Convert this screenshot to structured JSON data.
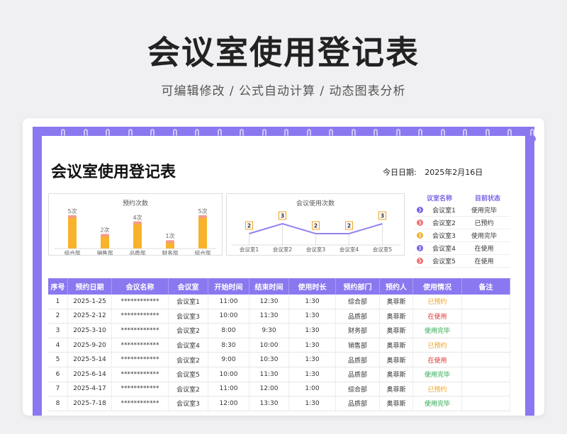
{
  "hero": {
    "title": "会议室使用登记表",
    "subtitle": "可编辑修改 /  公式自动计算  /  动态图表分析"
  },
  "doc": {
    "title": "会议室使用登记表",
    "date_label": "今日日期:",
    "date_value": "2025年2月16日"
  },
  "chart_data": [
    {
      "type": "bar",
      "title": "预约次数",
      "categories": [
        "综合部",
        "销售部",
        "品质部",
        "财务部",
        "综合部"
      ],
      "values": [
        5,
        2,
        4,
        1,
        5
      ],
      "labels": [
        "5次",
        "2次",
        "4次",
        "1次",
        "5次"
      ],
      "ylim": [
        0,
        5
      ],
      "colors": {
        "bar": "#f7b32b",
        "top": "#f59a8a"
      }
    },
    {
      "type": "line",
      "title": "会议使用次数",
      "categories": [
        "会议室1",
        "会议室2",
        "会议室3",
        "会议室4",
        "会议室5"
      ],
      "values": [
        2,
        3,
        2,
        2,
        3
      ],
      "ylim": [
        1,
        4
      ],
      "colors": {
        "line": "#9582ee",
        "label_border": "#f0a020"
      }
    }
  ],
  "status_panel": {
    "headers": [
      "议室名称",
      "目前状态"
    ],
    "rows": [
      {
        "name": "会议室1",
        "status": "使用完毕",
        "icon": "chevron-right-icon",
        "color": "#7a63e8"
      },
      {
        "name": "会议室2",
        "status": "已预约",
        "icon": "chevron-right-icon",
        "color": "#f07070"
      },
      {
        "name": "会议室3",
        "status": "使用完毕",
        "icon": "chevron-right-icon",
        "color": "#f0b030"
      },
      {
        "name": "会议室4",
        "status": "在使用",
        "icon": "chevron-right-icon",
        "color": "#7a63e8"
      },
      {
        "name": "会议室5",
        "status": "在使用",
        "icon": "chevron-right-icon",
        "color": "#f07070"
      }
    ]
  },
  "table": {
    "headers": [
      "序号",
      "预约日期",
      "会议名称",
      "会议室",
      "开始时间",
      "结束时间",
      "使用时长",
      "预约部门",
      "预约人",
      "使用情况",
      "备注"
    ],
    "status_colors": {
      "已预约": "#f0a020",
      "在使用": "#e03030",
      "使用完毕": "#2aa84a"
    },
    "rows": [
      [
        "1",
        "2025-1-25",
        "************",
        "会议室1",
        "11:00",
        "12:30",
        "1:30",
        "综合部",
        "奥菲斯",
        "已预约",
        ""
      ],
      [
        "2",
        "2025-2-12",
        "************",
        "会议室3",
        "10:00",
        "11:30",
        "1:30",
        "品质部",
        "奥菲斯",
        "在使用",
        ""
      ],
      [
        "3",
        "2025-3-10",
        "************",
        "会议室2",
        "8:00",
        "9:30",
        "1:30",
        "财务部",
        "奥菲斯",
        "使用完毕",
        ""
      ],
      [
        "4",
        "2025-9-20",
        "************",
        "会议室4",
        "8:30",
        "10:00",
        "1:30",
        "销售部",
        "奥菲斯",
        "已预约",
        ""
      ],
      [
        "5",
        "2025-5-14",
        "************",
        "会议室2",
        "9:00",
        "10:30",
        "1:30",
        "品质部",
        "奥菲斯",
        "在使用",
        ""
      ],
      [
        "6",
        "2025-6-14",
        "************",
        "会议室5",
        "10:00",
        "11:30",
        "1:30",
        "品质部",
        "奥菲斯",
        "使用完毕",
        ""
      ],
      [
        "7",
        "2025-4-17",
        "************",
        "会议室2",
        "11:00",
        "12:00",
        "1:00",
        "综合部",
        "奥菲斯",
        "已预约",
        ""
      ],
      [
        "8",
        "2025-7-18",
        "************",
        "会议室3",
        "12:00",
        "13:30",
        "1:30",
        "品质部",
        "奥菲斯",
        "使用完毕",
        ""
      ]
    ]
  }
}
